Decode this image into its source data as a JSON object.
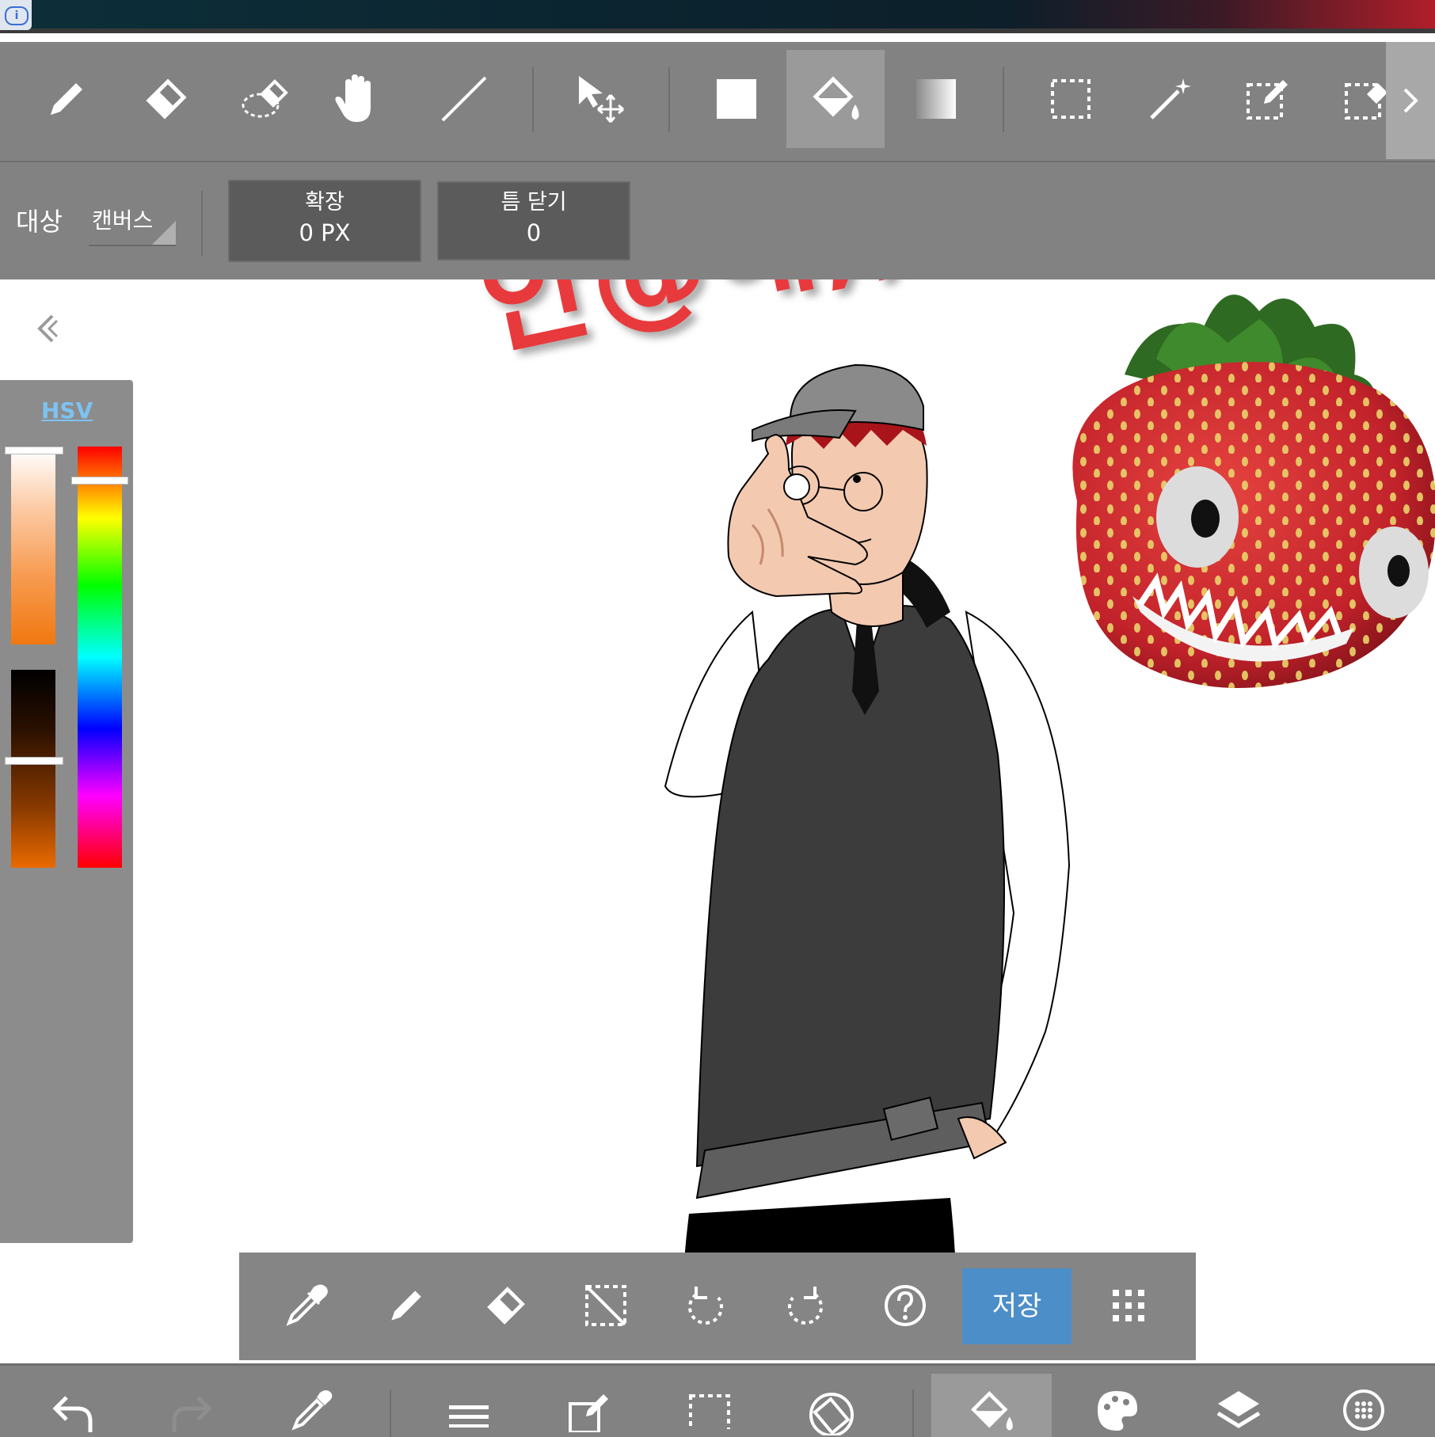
{
  "status_bar": {
    "info_glyph": "i"
  },
  "toolbar": {
    "tools": [
      "pencil-icon",
      "eraser-icon",
      "lasso-eraser-icon",
      "hand-icon",
      "line-icon",
      "move-icon",
      "rect-fill-icon",
      "bucket-icon",
      "gradient-icon",
      "rect-select-icon",
      "magic-wand-icon",
      "select-pen-icon",
      "select-eraser-icon"
    ],
    "active_tool": "bucket-icon"
  },
  "options": {
    "target_label": "대상",
    "target_value": "캔버스",
    "expand_label": "확장",
    "expand_value": "0 PX",
    "gap_label": "틈 닫기",
    "gap_value": "0"
  },
  "canvas": {
    "caption_text": "안@해;;",
    "caption_color": "#e83a3c"
  },
  "color_panel": {
    "mode_label": "HSV",
    "mode_color": "#7cc2f2",
    "current_color": "#d55a00"
  },
  "quick_bar": {
    "save_label": "저장",
    "save_color": "#4c8ec8",
    "buttons": [
      "eyedropper-icon",
      "pencil-icon",
      "eraser-icon",
      "deselect-icon",
      "undo-icon",
      "redo-icon",
      "help-icon",
      "save-button",
      "grid-menu-icon"
    ]
  },
  "bottom_nav": {
    "items": [
      "undo-icon",
      "redo-icon",
      "eyedropper-icon",
      "menu-icon",
      "edit-icon",
      "selection-icon",
      "rotate-icon",
      "bucket-icon",
      "palette-icon",
      "layers-icon",
      "materials-icon"
    ],
    "active_item": "bucket-icon"
  }
}
